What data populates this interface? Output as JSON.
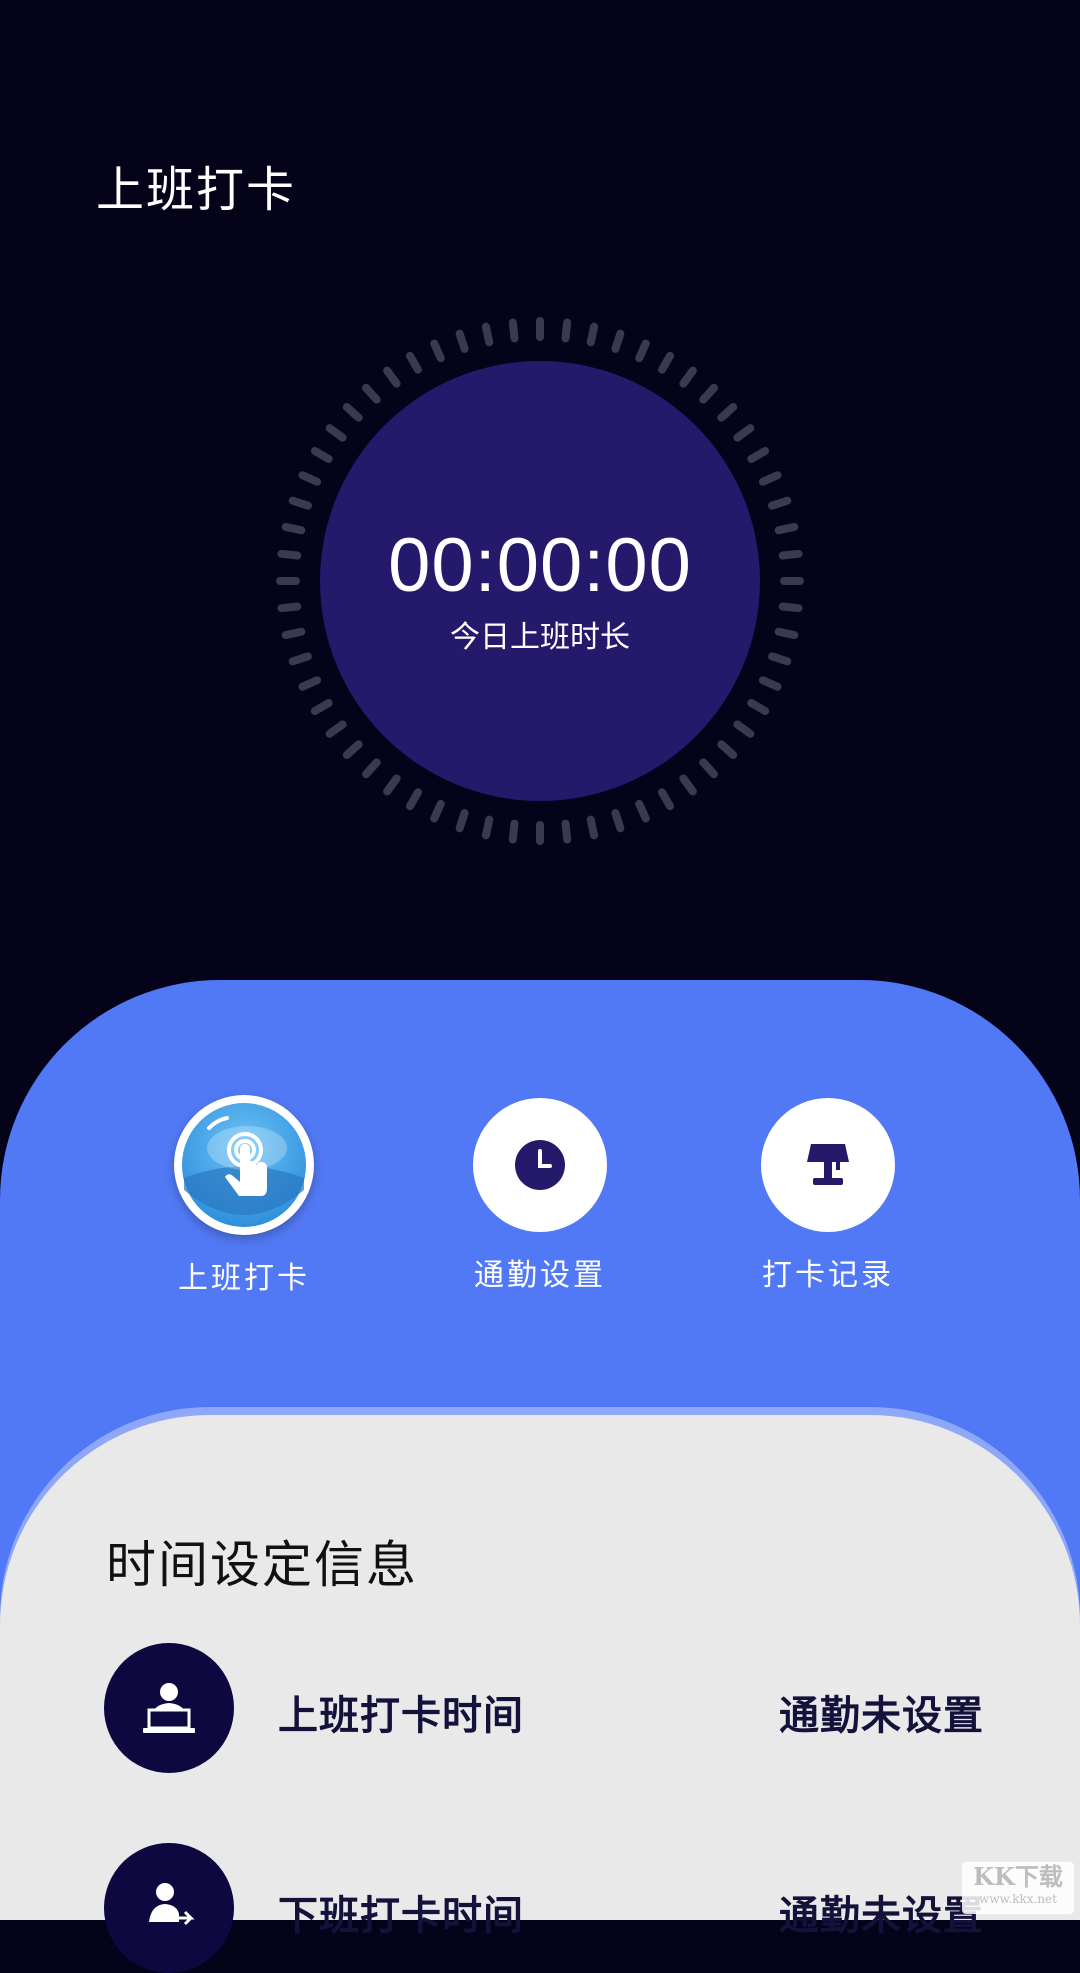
{
  "header": {
    "title": "上班打卡"
  },
  "timer": {
    "value": "00:00:00",
    "label": "今日上班时长"
  },
  "actions": [
    {
      "label": "上班打卡",
      "icon": "tap-hand-icon",
      "active": true
    },
    {
      "label": "通勤设置",
      "icon": "clock-icon",
      "active": false
    },
    {
      "label": "打卡记录",
      "icon": "lamp-icon",
      "active": false
    }
  ],
  "info": {
    "title": "时间设定信息",
    "rows": [
      {
        "label": "上班打卡时间",
        "value": "通勤未设置",
        "icon": "worker-laptop-icon"
      },
      {
        "label": "下班打卡时间",
        "value": "通勤未设置",
        "icon": "worker-leave-icon"
      }
    ]
  },
  "watermark": {
    "main": "KK下载",
    "sub": "www.kkx.net"
  },
  "colors": {
    "background": "#05031a",
    "timer_circle": "#24196b",
    "blue_panel": "#5279f5",
    "info_panel": "#e9e9ea",
    "icon_dark": "#0d0840"
  }
}
